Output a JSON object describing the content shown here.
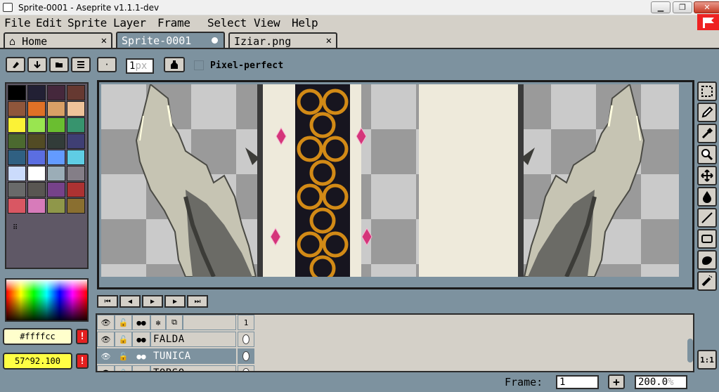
{
  "window": {
    "title": "Sprite-0001 - Aseprite v1.1.1-dev",
    "min_glyph": "▁",
    "max_glyph": "❐",
    "close_glyph": "✕"
  },
  "menu": [
    "File",
    "Edit",
    "Sprite",
    "Layer",
    "Frame",
    "Select",
    "View",
    "Help"
  ],
  "tabs": [
    {
      "label": "Home",
      "icon": "home-icon",
      "close": "✕",
      "active": false
    },
    {
      "label": "Sprite-0001",
      "active": true,
      "modified": true
    },
    {
      "label": "Iziar.png",
      "close": "✕",
      "active": false
    }
  ],
  "context_bar": {
    "brush_size": "1",
    "brush_unit": "px",
    "pixel_perfect_label": "Pixel-perfect",
    "pixel_perfect_checked": false,
    "single_dot": "·"
  },
  "palette": {
    "colors": [
      "#000000",
      "#222034",
      "#45283c",
      "#663931",
      "#8f563b",
      "#df7126",
      "#d9a066",
      "#eec39a",
      "#fbf236",
      "#99e550",
      "#6abe30",
      "#37946e",
      "#4b692f",
      "#524b24",
      "#323c39",
      "#3f3f74",
      "#306082",
      "#5b6ee1",
      "#639bff",
      "#5fcde4",
      "#cbdbfc",
      "#ffffff",
      "#9badb7",
      "#847e87",
      "#696a6a",
      "#595652",
      "#76428a",
      "#ac3232",
      "#d95763",
      "#d77bba",
      "#8f974a",
      "#8a6f30"
    ],
    "more_label": "⠿"
  },
  "colors": {
    "foreground_hex": "#ffffcc",
    "background_text": "57^92.100",
    "warning_mark": "!",
    "accent": "#7d929f"
  },
  "animation": {
    "first": "⏮",
    "prev": "◀",
    "play": "▶",
    "next": "▶",
    "last": "⏭"
  },
  "timeline": {
    "header_frame": "1",
    "layers": [
      {
        "name": "FALDA",
        "selected": false
      },
      {
        "name": "TUNICA",
        "selected": true
      },
      {
        "name": "TORSO",
        "selected": false
      }
    ],
    "eye": "👁",
    "lock": "🔓",
    "continuous": "●●",
    "gear": "✻",
    "onion": "⧉"
  },
  "status": {
    "frame_label": "Frame:",
    "frame_value": "1",
    "add_label": "+",
    "zoom_value": "200.0",
    "zoom_unit": "%"
  },
  "tools": {
    "actual_size_label": "1:1"
  }
}
